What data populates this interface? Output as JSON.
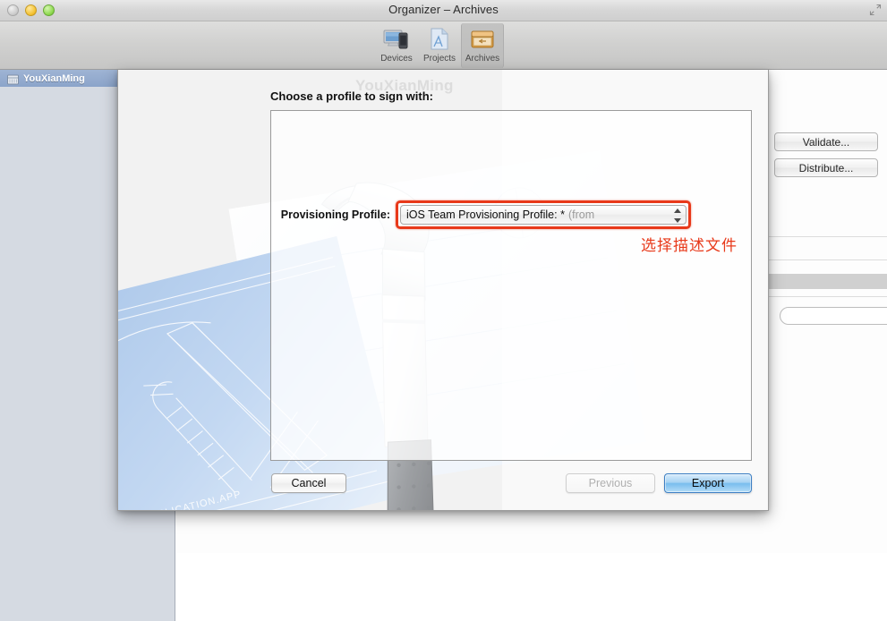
{
  "window": {
    "title": "Organizer – Archives",
    "controls": {
      "close": "close-button",
      "minimize": "minimize-button",
      "zoom": "zoom-button"
    }
  },
  "toolbar": {
    "items": [
      {
        "label": "Devices",
        "icon": "devices-icon",
        "selected": false
      },
      {
        "label": "Projects",
        "icon": "projects-icon",
        "selected": false
      },
      {
        "label": "Archives",
        "icon": "archives-icon",
        "selected": true
      }
    ]
  },
  "sidebar": {
    "items": [
      {
        "label": "YouXianMing",
        "icon": "archive-group-icon",
        "selected": true
      }
    ]
  },
  "background": {
    "buttons": [
      {
        "label": "Validate..."
      },
      {
        "label": "Distribute..."
      }
    ]
  },
  "sheet": {
    "title": "Choose a profile to sign with:",
    "watermark": "YouXianMing",
    "field": {
      "label": "Provisioning Profile:",
      "value": "iOS Team Provisioning Profile: *",
      "value_dim": "(from",
      "control": "popup-button",
      "highlighted": true,
      "highlight_color": "#e8391a"
    },
    "annotation": {
      "text": "选择描述文件",
      "color": "#e8391a"
    },
    "buttons": {
      "cancel": "Cancel",
      "previous": "Previous",
      "export": "Export"
    }
  }
}
